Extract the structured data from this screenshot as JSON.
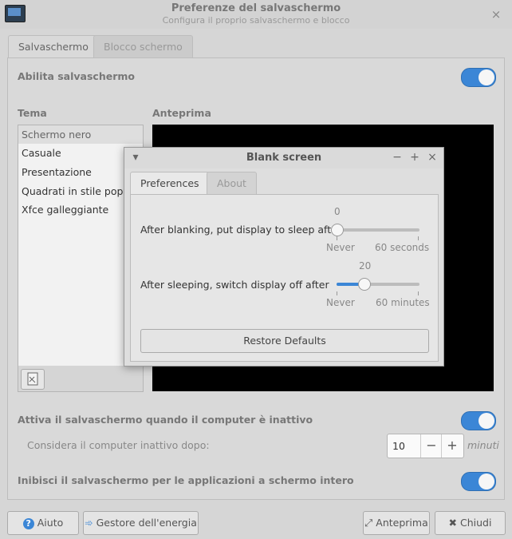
{
  "window": {
    "title": "Preferenze del salvaschermo",
    "subtitle": "Configura il proprio salvaschermo e blocco",
    "close_glyph": "×"
  },
  "tabs": [
    "Salvaschermo",
    "Blocco schermo"
  ],
  "enable_screensaver": {
    "label": "Abilita salvaschermo",
    "on": true
  },
  "theme": {
    "header": "Tema",
    "items": [
      "Schermo nero",
      "Casuale",
      "Presentazione",
      "Quadrati in stile pop ar",
      "Xfce galleggiante"
    ],
    "selected": 0
  },
  "preview": {
    "header": "Anteprima"
  },
  "idle": {
    "activate_label": "Attiva il salvaschermo quando il computer è inattivo",
    "activate_on": true,
    "consider_label": "Considera il computer inattivo dopo:",
    "value": "10",
    "unit": "minuti",
    "minus": "−",
    "plus": "+"
  },
  "inhibit": {
    "label": "Inibisci il salvaschermo per le applicazioni a schermo intero",
    "on": true
  },
  "buttons": {
    "help": "Aiuto",
    "power": "Gestore dell'energia",
    "preview": "Anteprima",
    "close": "Chiudi"
  },
  "dialog": {
    "title": "Blank screen",
    "menu_glyph": "▾",
    "min_glyph": "−",
    "max_glyph": "+",
    "close_glyph": "×",
    "tabs": [
      "Preferences",
      "About"
    ],
    "sleep": {
      "label": "After blanking, put display to sleep after",
      "value": "0",
      "fraction": 0.0,
      "min_label": "Never",
      "max_label": "60 seconds"
    },
    "off": {
      "label": "After sleeping, switch display off after",
      "value": "20",
      "fraction": 0.333,
      "min_label": "Never",
      "max_label": "60 minutes"
    },
    "restore": "Restore Defaults"
  },
  "colors": {
    "accent": "#3b86d6"
  }
}
